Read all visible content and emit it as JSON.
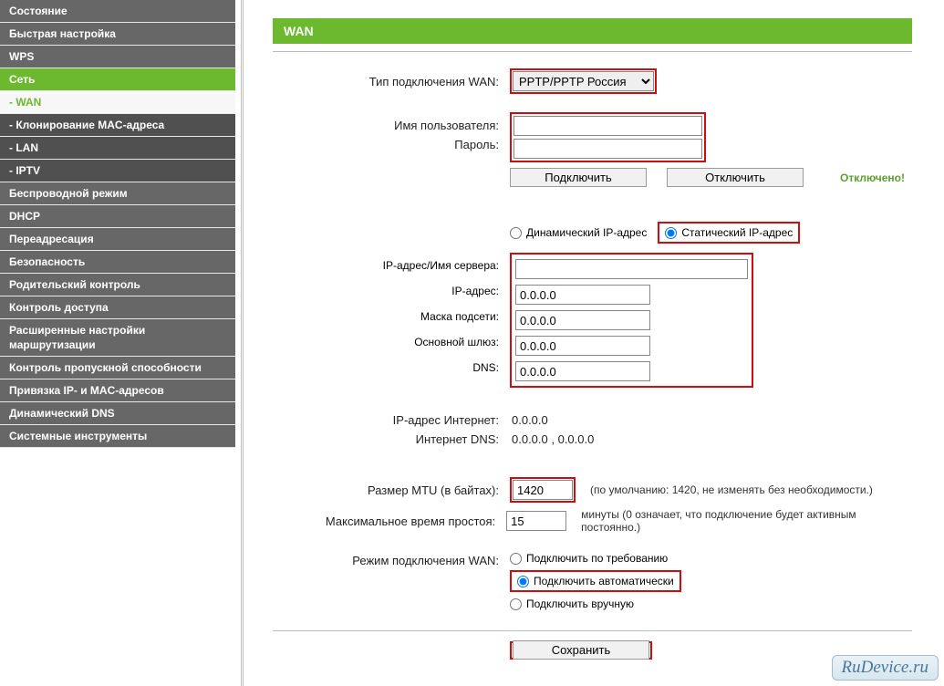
{
  "sidebar": {
    "items": [
      {
        "label": "Состояние",
        "cls": "top"
      },
      {
        "label": "Быстрая настройка",
        "cls": "top"
      },
      {
        "label": "WPS",
        "cls": "top"
      },
      {
        "label": "Сеть",
        "cls": "active-top"
      },
      {
        "label": "- WAN",
        "cls": "active-sub"
      },
      {
        "label": "- Клонирование MAC-адреса",
        "cls": "sub"
      },
      {
        "label": "- LAN",
        "cls": "sub"
      },
      {
        "label": "- IPTV",
        "cls": "sub"
      },
      {
        "label": "Беспроводной режим",
        "cls": "top"
      },
      {
        "label": "DHCP",
        "cls": "top"
      },
      {
        "label": "Переадресация",
        "cls": "top"
      },
      {
        "label": "Безопасность",
        "cls": "top"
      },
      {
        "label": "Родительский контроль",
        "cls": "top"
      },
      {
        "label": "Контроль доступа",
        "cls": "top"
      },
      {
        "label": "Расширенные настройки маршрутизации",
        "cls": "top"
      },
      {
        "label": "Контроль пропускной способности",
        "cls": "top"
      },
      {
        "label": "Привязка IP- и MAC-адресов",
        "cls": "top"
      },
      {
        "label": "Динамический DNS",
        "cls": "top"
      },
      {
        "label": "Системные инструменты",
        "cls": "top"
      }
    ]
  },
  "page": {
    "title": "WAN",
    "labels": {
      "wan_type": "Тип подключения WAN:",
      "username": "Имя пользователя:",
      "password": "Пароль:",
      "connect": "Подключить",
      "disconnect": "Отключить",
      "status": "Отключено!",
      "dynamic_ip": "Динамический IP-адрес",
      "static_ip": "Статический IP-адрес",
      "server": "IP-адрес/Имя сервера:",
      "ip": "IP-адрес:",
      "mask": "Маска подсети:",
      "gw": "Основной шлюз:",
      "dns": "DNS:",
      "internet_ip": "IP-адрес Интернет:",
      "internet_dns": "Интернет DNS:",
      "mtu": "Размер MTU (в байтах):",
      "mtu_note": "(по умолчанию: 1420, не изменять без необходимости.)",
      "idle": "Максимальное время простоя:",
      "idle_note": "минуты (0 означает, что подключение будет активным постоянно.)",
      "conn_mode": "Режим подключения WAN:",
      "on_demand": "Подключить по требованию",
      "auto": "Подключить автоматически",
      "manual": "Подключить вручную",
      "save": "Сохранить"
    },
    "values": {
      "wan_type": "PPTP/PPTP Россия",
      "username": "",
      "password": "",
      "server": "",
      "ip": "0.0.0.0",
      "mask": "0.0.0.0",
      "gw": "0.0.0.0",
      "dns": "0.0.0.0",
      "internet_ip": "0.0.0.0",
      "internet_dns": "0.0.0.0 , 0.0.0.0",
      "mtu": "1420",
      "idle": "15"
    }
  },
  "watermark": "RuDevice.ru"
}
